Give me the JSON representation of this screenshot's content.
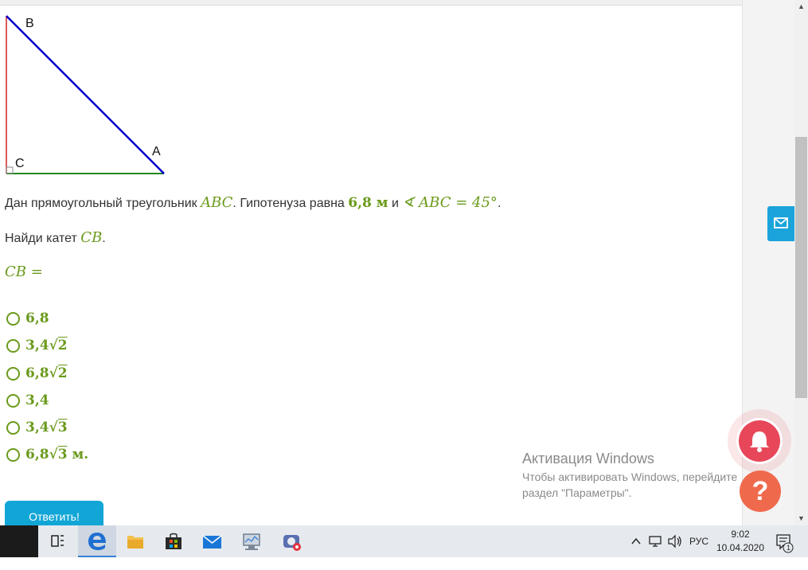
{
  "diagram": {
    "vertex_b": "B",
    "vertex_c": "C",
    "vertex_a": "A"
  },
  "problem": {
    "line1_prefix": "Дан прямоугольный треугольник ",
    "triangle": "ABC",
    "line1_mid": ". Гипотенуза равна ",
    "hyp_value": "6,8 м",
    "conj": " и ",
    "angle_expr": "∢ ABC = 45°",
    "line1_end": ".",
    "line2_prefix": "Найди катет ",
    "leg": "CB",
    "line2_end": ".",
    "answer_expr": "CB ="
  },
  "options": [
    {
      "coef": "6,8",
      "root": "",
      "suffix": ""
    },
    {
      "coef": "3,4",
      "root": "2",
      "suffix": ""
    },
    {
      "coef": "6,8",
      "root": "2",
      "suffix": ""
    },
    {
      "coef": "3,4",
      "root": "",
      "suffix": ""
    },
    {
      "coef": "3,4",
      "root": "3",
      "suffix": ""
    },
    {
      "coef": "6,8",
      "root": "3",
      "suffix": " м."
    }
  ],
  "submit_label": "Ответить!",
  "activation": {
    "title": "Активация Windows",
    "line1": "Чтобы активировать Windows, перейдите",
    "line2": "раздел \"Параметры\"."
  },
  "tray": {
    "language": "РУС",
    "time": "9:02",
    "date": "10.04.2020",
    "notification_count": "1"
  },
  "colors": {
    "math_green": "#6b9a1c",
    "hypotenuse": "#0000cc",
    "leg_cb": "#cc2222",
    "leg_ca": "#228822",
    "accent_blue": "#12a6d6"
  },
  "icons": [
    "task-view-icon",
    "edge-icon",
    "file-explorer-icon",
    "store-icon",
    "mail-icon",
    "network-monitor-icon",
    "media-app-icon",
    "chevron-up-icon",
    "network-icon",
    "volume-icon",
    "notification-icon",
    "envelope-icon",
    "bell-icon",
    "help-icon"
  ]
}
